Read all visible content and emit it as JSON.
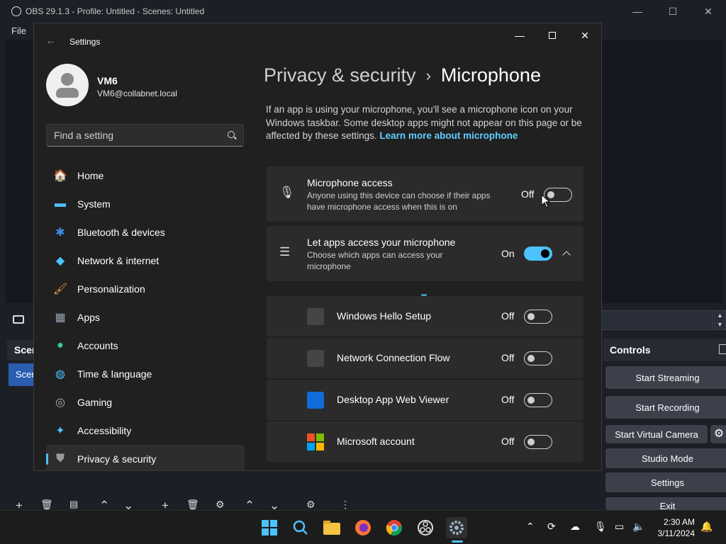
{
  "obs": {
    "title": "OBS 29.1.3 - Profile: Untitled - Scenes: Untitled",
    "menu_file": "File",
    "scenes_header": "Scenes",
    "scene_item": "Scene",
    "controls_header": "Controls",
    "buttons": {
      "start_streaming": "Start Streaming",
      "start_recording": "Start Recording",
      "start_virtual_camera": "Start Virtual Camera",
      "studio_mode": "Studio Mode",
      "settings": "Settings",
      "exit": "Exit"
    },
    "window_controls": {
      "minimize": "—",
      "maximize": "☐",
      "close": "✕"
    }
  },
  "settings": {
    "window_title": "Settings",
    "back_glyph": "←",
    "window_controls": {
      "minimize": "—",
      "close": "✕"
    },
    "profile": {
      "name": "VM6",
      "email": "VM6@collabnet.local"
    },
    "search": {
      "placeholder": "Find a setting"
    },
    "nav": [
      {
        "label": "Home",
        "icon": "home-icon",
        "glyph": "🏠",
        "color": "#e8a33c"
      },
      {
        "label": "System",
        "icon": "system-icon",
        "glyph": "▬",
        "color": "#4cc2ff"
      },
      {
        "label": "Bluetooth & devices",
        "icon": "bluetooth-icon",
        "glyph": "✱",
        "color": "#3a8ee6"
      },
      {
        "label": "Network & internet",
        "icon": "wifi-icon",
        "glyph": "◆",
        "color": "#4cc2ff"
      },
      {
        "label": "Personalization",
        "icon": "brush-icon",
        "glyph": "🖌",
        "color": "#f0a050"
      },
      {
        "label": "Apps",
        "icon": "apps-icon",
        "glyph": "▦",
        "color": "#9aa6b8"
      },
      {
        "label": "Accounts",
        "icon": "accounts-icon",
        "glyph": "●",
        "color": "#3cc7a0"
      },
      {
        "label": "Time & language",
        "icon": "globe-icon",
        "glyph": "◍",
        "color": "#4cc2ff"
      },
      {
        "label": "Gaming",
        "icon": "gamepad-icon",
        "glyph": "◎",
        "color": "#b0b0b0"
      },
      {
        "label": "Accessibility",
        "icon": "accessibility-icon",
        "glyph": "✦",
        "color": "#4cc2ff"
      },
      {
        "label": "Privacy & security",
        "icon": "shield-icon",
        "glyph": "⛊",
        "color": "#9a9a9a"
      }
    ],
    "breadcrumb": {
      "parent": "Privacy & security",
      "separator": "›",
      "current": "Microphone"
    },
    "description": "If an app is using your microphone, you'll see a microphone icon on your Windows taskbar. Some desktop apps might not appear on this page or be affected by these settings.",
    "learn_more": "Learn more about microphone",
    "mic_access": {
      "title": "Microphone access",
      "subtitle": "Anyone using this device can choose if their apps have microphone access when this is on",
      "state_label": "Off",
      "state": "off"
    },
    "let_apps": {
      "title": "Let apps access your microphone",
      "subtitle": "Choose which apps can access your microphone",
      "state_label": "On",
      "state": "on"
    },
    "apps": [
      {
        "name": "Windows Hello Setup",
        "state_label": "Off",
        "tile_color": "#454545"
      },
      {
        "name": "Network Connection Flow",
        "state_label": "Off",
        "tile_color": "#454545"
      },
      {
        "name": "Desktop App Web Viewer",
        "state_label": "Off",
        "tile_color": "#0f6cd9"
      },
      {
        "name": "Microsoft account",
        "state_label": "Off",
        "tile_color": "multi"
      }
    ]
  },
  "taskbar": {
    "time": "2:30 AM",
    "date": "3/11/2024",
    "accent": "#4cc2ff"
  }
}
